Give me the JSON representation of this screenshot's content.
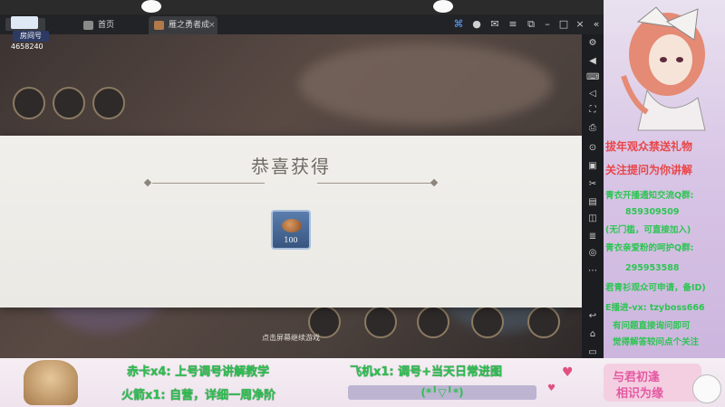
{
  "window": {
    "tabs": [
      {
        "label": "首页"
      },
      {
        "label": "雁之勇者成名..."
      }
    ],
    "close_tab_glyph": "×"
  },
  "room": {
    "label": "房间号",
    "number": "4658240"
  },
  "dialog": {
    "title": "恭喜获得",
    "item": {
      "icon": "bread-icon",
      "count": "100"
    },
    "continue_hint": "点击屏幕继续游戏"
  },
  "right_panel": {
    "lines": [
      {
        "text": "拔年观众禁送礼物",
        "style": "red"
      },
      {
        "text": "关注提问为你讲解",
        "style": "red"
      },
      {
        "text": "青衣开播通知交流Q群:",
        "style": "green"
      },
      {
        "text": "859309509",
        "style": "green"
      },
      {
        "text": "(无门槛，可直接加入)",
        "style": "green"
      },
      {
        "text": "青衣亲爱粉的呵护Q群:",
        "style": "green"
      },
      {
        "text": "295953588",
        "style": "green"
      },
      {
        "text": "君青衫观众可申请，备ID)",
        "style": "green"
      },
      {
        "text": "E播进-vx: tzyboss666",
        "style": "green"
      },
      {
        "text": "有问题直接询问即可",
        "style": "green"
      },
      {
        "text": "觉得解答较问点个关注",
        "style": "green"
      }
    ]
  },
  "bottom": {
    "left_line1": "赤卡x4: 上号调号讲解教学",
    "left_line2": "火箭x1: 自营，详细一周净阶",
    "mid_line1": "飞机x1: 调号+当天日常进图",
    "emote": "(*╹▽╹*)",
    "sign_line1": "与君初逢",
    "sign_line2": "相识为缘"
  },
  "colors": {
    "accent_red": "#e8464a",
    "accent_green": "#2cc552",
    "dialog_bg": "#ebe9e4",
    "item_frame": "#38557f"
  }
}
